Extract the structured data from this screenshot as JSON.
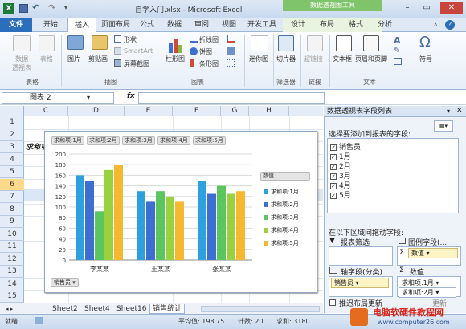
{
  "window": {
    "title": "自学入门.xlsx - Microsoft Excel",
    "context_title": "数据透视图工具"
  },
  "tabs": [
    "文件",
    "开始",
    "插入",
    "页面布局",
    "公式",
    "数据",
    "审阅",
    "视图",
    "开发工具",
    "设计",
    "布局",
    "格式",
    "分析"
  ],
  "ribbon": {
    "items": [
      "数据\n透视表",
      "表格",
      "图片",
      "剪贴画",
      "形状",
      "SmartArt",
      "屏幕截图",
      "柱形图",
      "折线图",
      "饼图",
      "条形图",
      "迷你图",
      "切片器",
      "超链接",
      "文本框",
      "页眉和页脚",
      "符号"
    ],
    "groups": [
      "表格",
      "插图",
      "图表",
      "筛选器",
      "链接",
      "文本"
    ]
  },
  "formula": {
    "name": "图表 2",
    "fx": "fx"
  },
  "grid": {
    "columns": [
      "C",
      "D",
      "E",
      "F",
      "G",
      "H"
    ],
    "rows": [
      "1",
      "2",
      "3",
      "4",
      "5",
      "6",
      "7",
      "8",
      "9",
      "10",
      "11",
      "12",
      "13",
      "14",
      "15"
    ],
    "cell_c3": "求和项"
  },
  "chart_data": {
    "type": "bar",
    "categories": [
      "李某某",
      "王某某",
      "张某某"
    ],
    "series": [
      {
        "name": "求和项:1月",
        "values": [
          160,
          130,
          150
        ]
      },
      {
        "name": "求和项:2月",
        "values": [
          150,
          110,
          125
        ]
      },
      {
        "name": "求和项:3月",
        "values": [
          92,
          130,
          140
        ]
      },
      {
        "name": "求和项:4月",
        "values": [
          170,
          120,
          125
        ]
      },
      {
        "name": "求和项:5月",
        "values": [
          180,
          110,
          130
        ]
      }
    ],
    "colors": [
      "#2ea0e0",
      "#3c6fcf",
      "#5bc65e",
      "#9bd03f",
      "#f5b930"
    ],
    "ylim": [
      0,
      200
    ],
    "yticks": [
      0,
      20,
      40,
      60,
      80,
      100,
      120,
      140,
      160,
      180,
      200
    ],
    "legend_title": "数值",
    "value_buttons": [
      "求和项:1月",
      "求和项:2月",
      "求和项:3月",
      "求和项:4月",
      "求和项:5月"
    ],
    "axis_filter": "销售员",
    "legend_position": "right",
    "grid": true
  },
  "sheet_tabs": [
    "Sheet2",
    "Sheet4",
    "Sheet16",
    "销售统计"
  ],
  "status": {
    "ready": "就绪",
    "avg": "平均值: 198.75",
    "count": "计数: 20",
    "sum": "求和: 3180"
  },
  "pane": {
    "title": "数据透视表字段列表",
    "choose_label": "选择要添加到报表的字段:",
    "fields": [
      "销售员",
      "1月",
      "2月",
      "3月",
      "4月",
      "5月"
    ],
    "drag_label": "在以下区域间拖动字段:",
    "report_filter": "报表筛选",
    "legend_fields": "图例字段(...",
    "legend_item": "数值",
    "axis_fields": "轴字段(分类)",
    "values_label": "数值",
    "axis_item": "销售员",
    "values_item1": "求和项:1月",
    "values_item2": "求和项:2月",
    "defer": "推迟布局更新",
    "update": "更新"
  },
  "watermark": {
    "line1": "电脑软硬件教程网",
    "line2": "www.computer26.com"
  }
}
